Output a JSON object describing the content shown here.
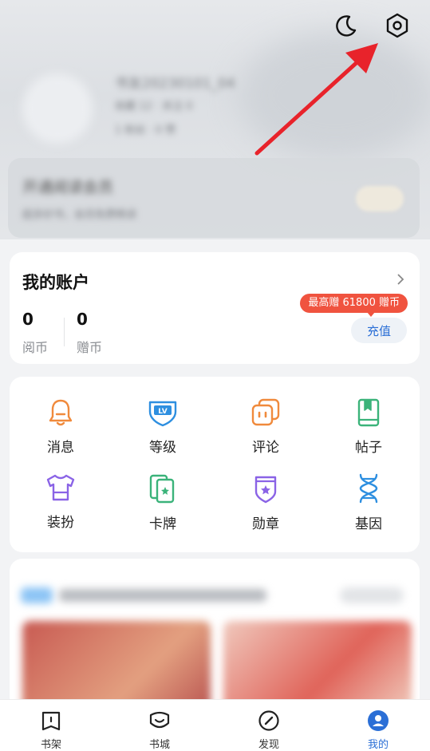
{
  "account": {
    "title": "我的账户",
    "read_coins_value": "0",
    "read_coins_label": "阅币",
    "gift_coins_value": "0",
    "gift_coins_label": "赠币",
    "promo_badge": "最高赠 61800 赠币",
    "recharge_label": "充值"
  },
  "grid": {
    "items": [
      {
        "label": "消息",
        "icon": "bell-icon",
        "color": "#f08a3c"
      },
      {
        "label": "等级",
        "icon": "level-shield-icon",
        "color": "#2e8fe0"
      },
      {
        "label": "评论",
        "icon": "comment-icon",
        "color": "#f08a3c"
      },
      {
        "label": "帖子",
        "icon": "post-book-icon",
        "color": "#3bb37a"
      },
      {
        "label": "装扮",
        "icon": "tshirt-icon",
        "color": "#8a63e6"
      },
      {
        "label": "卡牌",
        "icon": "card-icon",
        "color": "#3bb37a"
      },
      {
        "label": "勋章",
        "icon": "medal-icon",
        "color": "#8a63e6"
      },
      {
        "label": "基因",
        "icon": "dna-icon",
        "color": "#2e8fe0"
      }
    ]
  },
  "tabbar": {
    "items": [
      {
        "label": "书架",
        "icon": "bookshelf-icon",
        "active": false
      },
      {
        "label": "书城",
        "icon": "bookstore-icon",
        "active": false
      },
      {
        "label": "发现",
        "icon": "compass-icon",
        "active": false
      },
      {
        "label": "我的",
        "icon": "profile-icon",
        "active": true
      }
    ]
  },
  "header_icons": [
    "moon-icon",
    "settings-hexagon-icon"
  ],
  "colors": {
    "accent_blue": "#2b6fd6",
    "promo_red": "#f0533f",
    "annotation_arrow": "#e8232b"
  }
}
